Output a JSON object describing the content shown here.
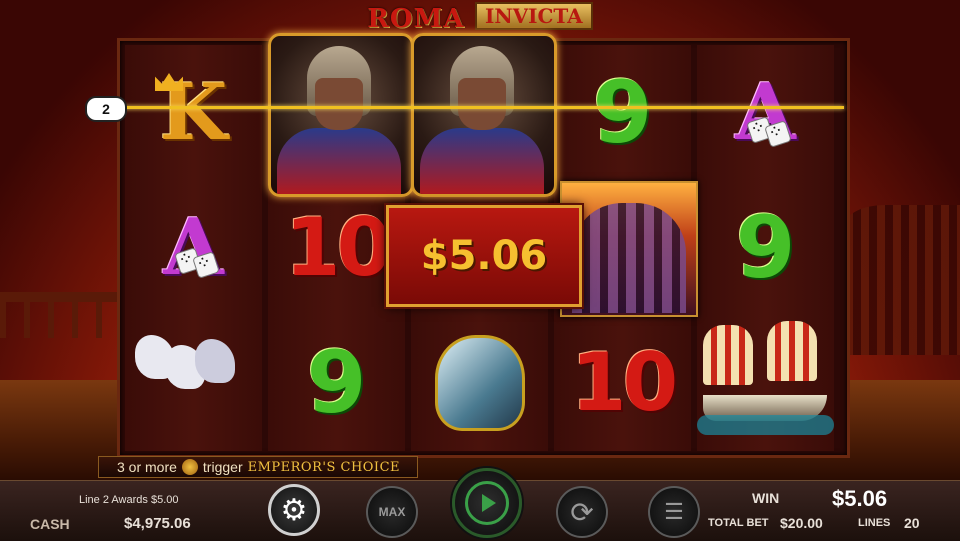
{
  "title": {
    "word1": "ROMA",
    "word2": "INVICTA"
  },
  "reels": {
    "col1": {
      "top": "K",
      "mid": "A",
      "bottom": "chariot-icon"
    },
    "col2": {
      "top": "soldier-icon",
      "mid": "10",
      "bottom": "9"
    },
    "col3": {
      "top": "soldier-icon",
      "mid": "",
      "bottom": "helmet-icon"
    },
    "col4": {
      "top": "9",
      "mid": "colosseum-icon",
      "bottom": "10"
    },
    "col5": {
      "top": "A",
      "mid": "9",
      "bottom": "ship-icon"
    }
  },
  "payline": {
    "number": "2",
    "color": "#f0c020"
  },
  "win_popup": {
    "amount": "$5.06"
  },
  "trigger": {
    "text1": "3 or more",
    "icon": "lion-icon",
    "text2": "trigger",
    "feature": "EMPEROR'S CHOICE"
  },
  "status": {
    "line_award": "Line 2 Awards $5.00"
  },
  "cash": {
    "label": "CASH",
    "value": "$4,975.06"
  },
  "win": {
    "label": "WIN",
    "value": "$5.06"
  },
  "total_bet": {
    "label": "TOTAL BET",
    "value": "$20.00"
  },
  "lines": {
    "label": "LINES",
    "value": "20"
  },
  "buttons": {
    "max_label": "MAX"
  },
  "colors": {
    "accent_gold": "#f6c030",
    "win_red": "#b81810",
    "spin_green": "#3aa048"
  }
}
